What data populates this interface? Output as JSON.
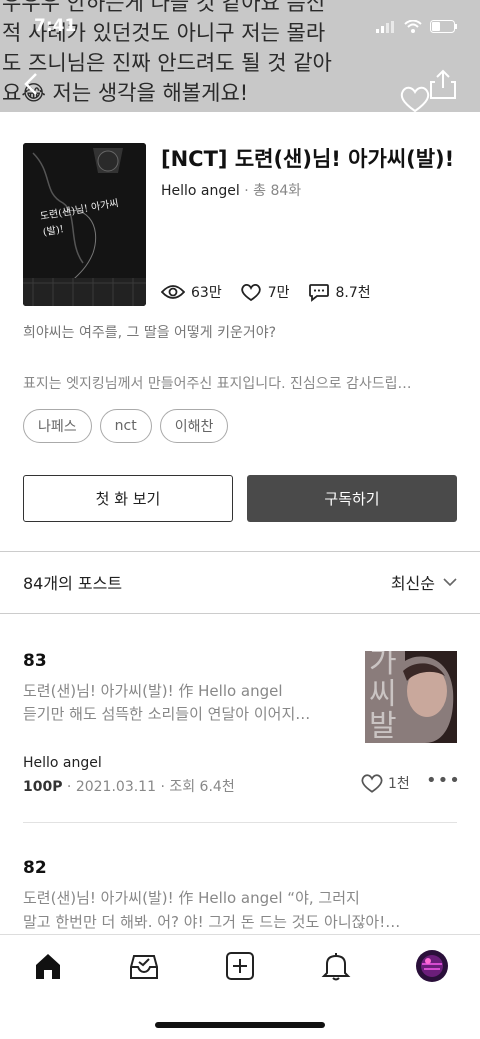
{
  "status_bar": {
    "time": "7:41"
  },
  "header": {
    "banner_text": "우우우 안하든게 나을 것 같아요 음신\n적 사례가 있던것도 아니구 저는 몰라\n도 즈니님은 진짜 안드려도 될 것 같아\n요😂 저는 생각을 해볼게요!"
  },
  "series": {
    "title": "[NCT] 도련(샌)님! 아가씨(발)!",
    "author": "Hello angel",
    "episode_count": " · 총 84화",
    "views": "63만",
    "likes": "7만",
    "comments": "8.7천",
    "summary": "희야씨는 여주를, 그 딸을 어떻게 키운거야?",
    "cover_note": "표지는 엣지킹님께서 만들어주신 표지입니다. 진심으로 감사드립…",
    "cover_text": "도련(샌)님! 아가씨(발)!",
    "tags": [
      "나페스",
      "nct",
      "이해찬"
    ]
  },
  "buttons": {
    "first": "첫 화 보기",
    "subscribe": "구독하기"
  },
  "post_list": {
    "count_label": "84개의 포스트",
    "sort_label": "최신순"
  },
  "posts": [
    {
      "number": "83",
      "line1": "도련(샌)님! 아가씨(발)! 作 Hello angel",
      "line2": "듣기만 해도 섬뜩한 소리들이 연달아 이어지…",
      "author": "Hello angel",
      "price": "100P",
      "meta": " · 2021.03.11 · 조회 6.4천",
      "likes": "1천",
      "thumb_text": "가\n씨\n발"
    },
    {
      "number": "82",
      "line1": "도련(샌)님! 아가씨(발)! 作 Hello angel     “야, 그러지",
      "line2": "말고 한번만 더 해봐. 어? 야! 그거 돈 드는 것도 아니잖아!…"
    }
  ],
  "colors": {
    "accent": "#4a4a4a",
    "header_bg": "#c8c8c8"
  }
}
